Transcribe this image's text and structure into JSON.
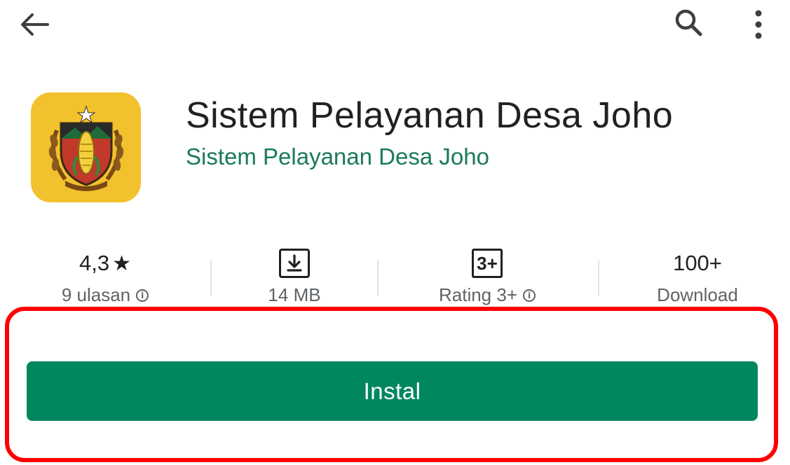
{
  "topbar": {
    "back_icon": "arrow-left-icon",
    "search_icon": "search-icon",
    "more_icon": "more-vertical-icon"
  },
  "app": {
    "icon": "village-emblem-icon",
    "title": "Sistem Pelayanan Desa Joho",
    "developer": "Sistem Pelayanan Desa Joho",
    "icon_bg": "#f2c12e"
  },
  "stats": {
    "rating": {
      "value": "4,3",
      "star": "★",
      "label": "9 ulasan"
    },
    "size": {
      "icon": "download-icon",
      "label": "14 MB"
    },
    "content_rating": {
      "badge": "3+",
      "label": "Rating 3+"
    },
    "downloads": {
      "value": "100+",
      "label": "Download"
    }
  },
  "install": {
    "label": "Instal",
    "color": "#01875f",
    "highlight_color": "#ff0000"
  }
}
